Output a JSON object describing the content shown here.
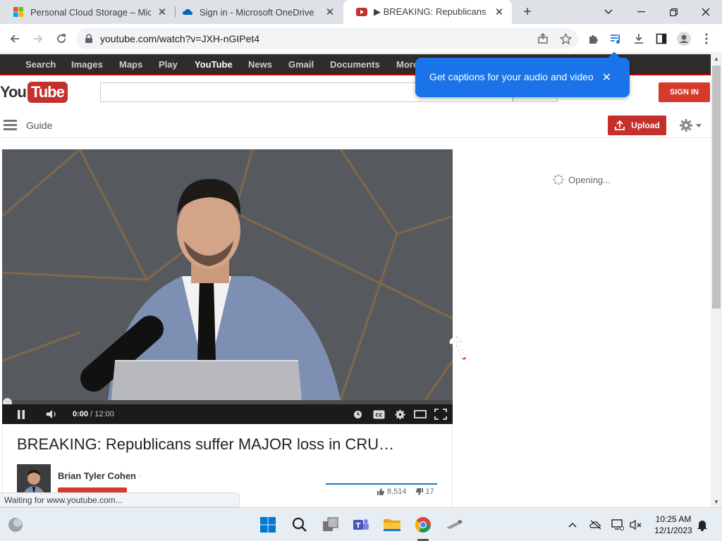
{
  "browser": {
    "tabs": [
      {
        "title": "Personal Cloud Storage – Microsoft",
        "active": false
      },
      {
        "title": "Sign in - Microsoft OneDrive",
        "active": false
      },
      {
        "title": "▶ BREAKING: Republicans suffer MAJOR loss",
        "active": true
      }
    ],
    "url": "youtube.com/watch?v=JXH-nGIPet4",
    "status": "Waiting for www.youtube.com..."
  },
  "gbar": {
    "links": [
      "Search",
      "Images",
      "Maps",
      "Play",
      "YouTube",
      "News",
      "Gmail",
      "Documents",
      "More"
    ]
  },
  "captions_popup": {
    "text": "Get captions for your audio and video"
  },
  "youtube": {
    "logo_you": "You",
    "logo_tube": "Tube",
    "signin": "SIGN IN",
    "guide": "Guide",
    "upload": "Upload",
    "loading": "Opening..."
  },
  "player": {
    "current_time": "0:00",
    "duration": "/ 12:00"
  },
  "video": {
    "title": "BREAKING: Republicans suffer MAJOR loss in CRU…",
    "channel": "Brian Tyler Cohen",
    "channel_dot": "·",
    "likes": "8,514",
    "dislikes": "17"
  },
  "taskbar": {
    "time": "10:25 AM",
    "date": "12/1/2023"
  },
  "colors": {
    "yt_red": "#c4302b",
    "chrome_blue": "#1a73e8"
  }
}
